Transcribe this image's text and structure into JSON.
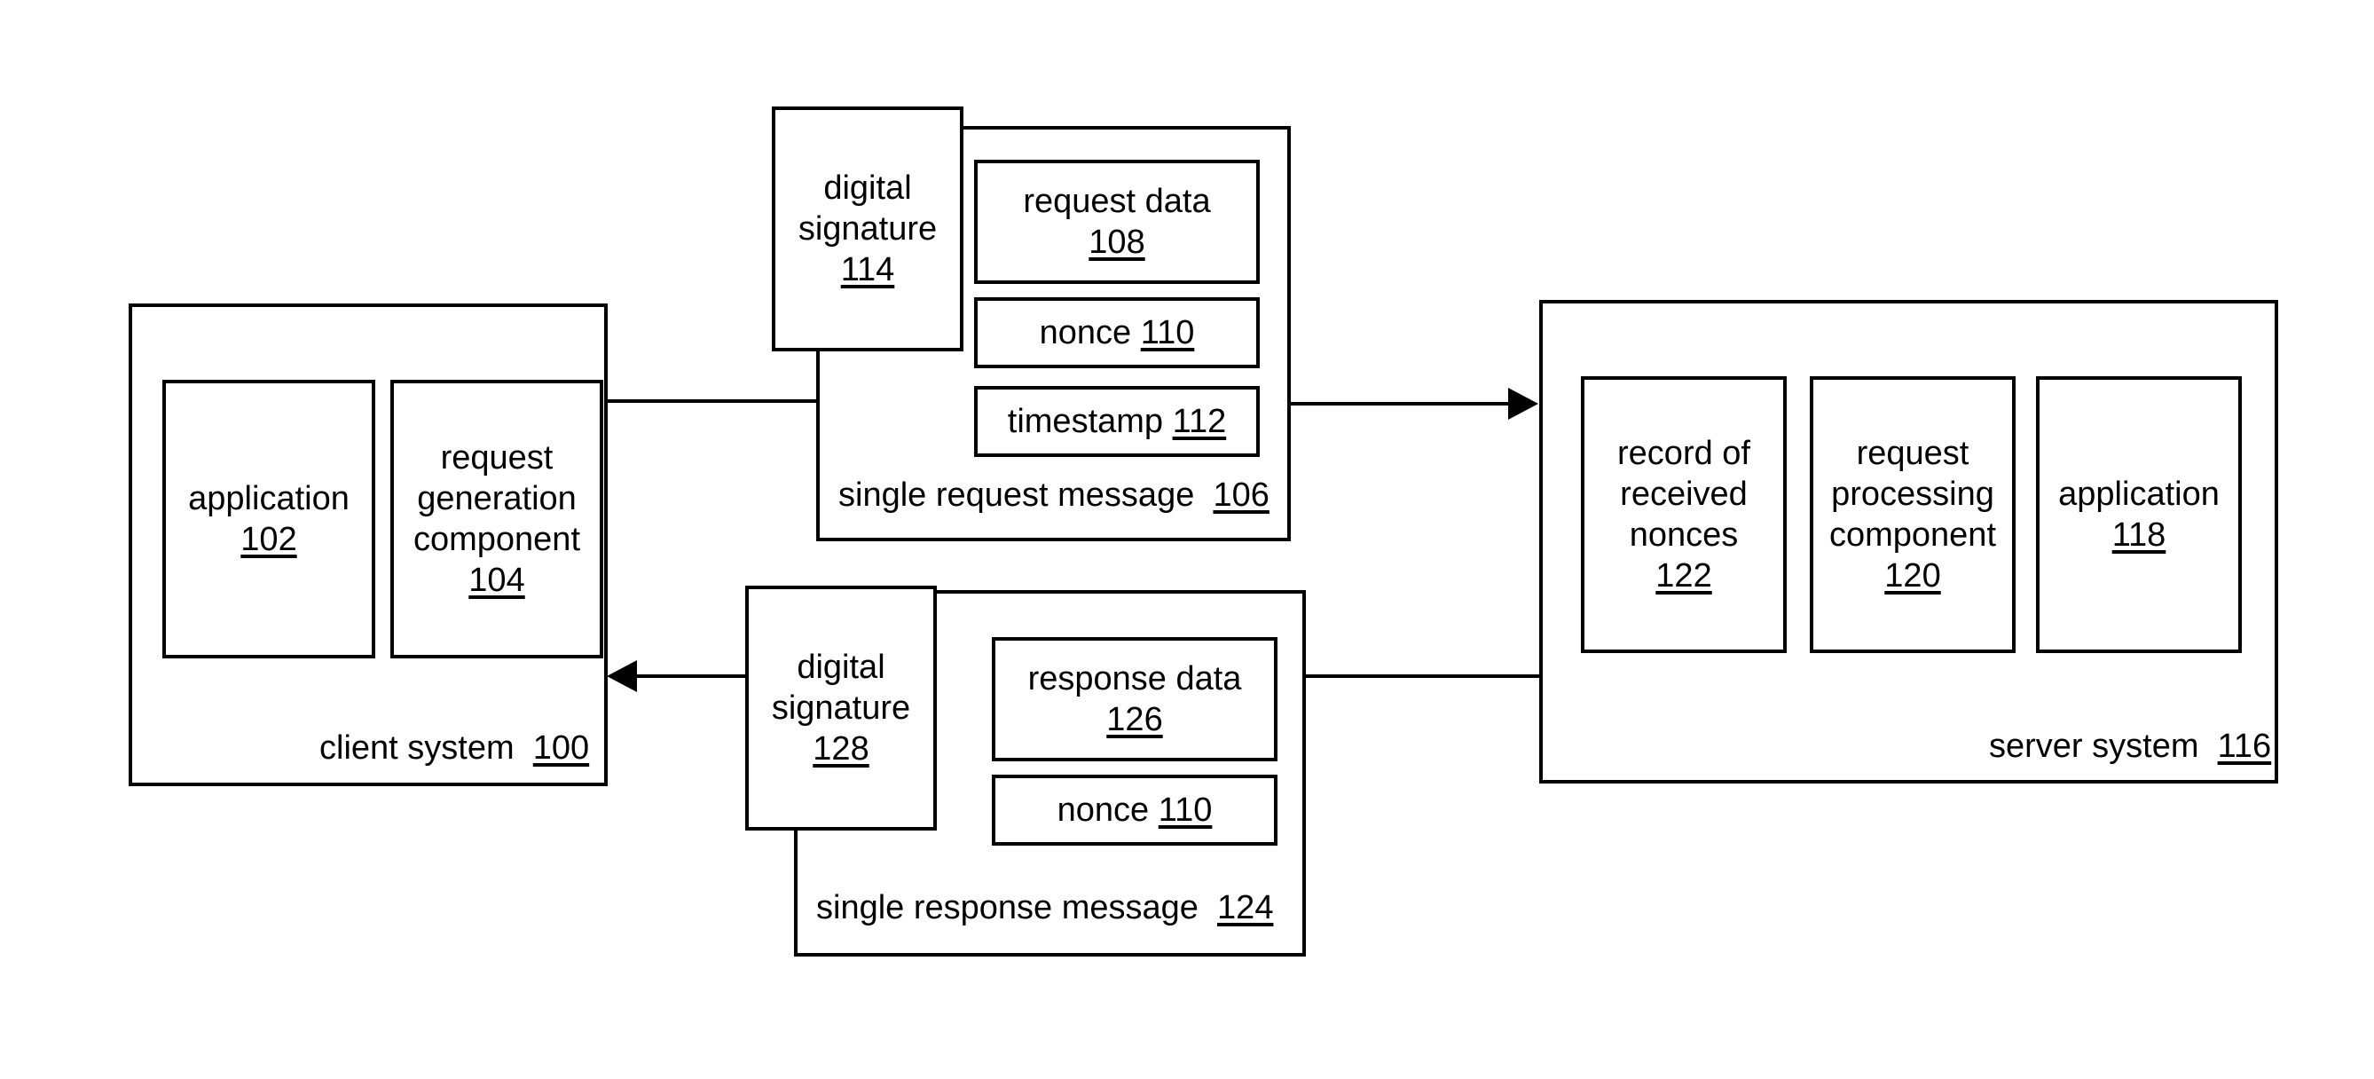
{
  "figure": {
    "type": "patent-block-diagram",
    "background_color": "#ffffff",
    "line_color": "#000000"
  },
  "client_system": {
    "label": "client system",
    "ref": "100",
    "blocks": [
      {
        "name": "application",
        "label": "application",
        "ref": "102"
      },
      {
        "name": "request-generation-component",
        "label": "request\ngeneration\ncomponent",
        "ref": "104"
      }
    ]
  },
  "request_message": {
    "label": "single request message",
    "ref": "106",
    "signature": {
      "label": "digital\nsignature",
      "ref": "114"
    },
    "fields": [
      {
        "name": "request-data",
        "label": "request data",
        "ref": "108",
        "inline": false
      },
      {
        "name": "nonce",
        "label": "nonce",
        "ref": "110",
        "inline": true
      },
      {
        "name": "timestamp",
        "label": "timestamp",
        "ref": "112",
        "inline": true
      }
    ]
  },
  "response_message": {
    "label": "single response message",
    "ref": "124",
    "signature": {
      "label": "digital\nsignature",
      "ref": "128"
    },
    "fields": [
      {
        "name": "response-data",
        "label": "response data",
        "ref": "126",
        "inline": false
      },
      {
        "name": "nonce",
        "label": "nonce",
        "ref": "110",
        "inline": true
      }
    ]
  },
  "server_system": {
    "label": "server system",
    "ref": "116",
    "blocks": [
      {
        "name": "record-of-received-nonces",
        "label": "record of\nreceived\nnonces",
        "ref": "122"
      },
      {
        "name": "request-processing-component",
        "label": "request\nprocessing\ncomponent",
        "ref": "120"
      },
      {
        "name": "application",
        "label": "application",
        "ref": "118"
      }
    ]
  },
  "connectors": [
    {
      "name": "client-to-request-message",
      "direction": "right",
      "arrowhead": false
    },
    {
      "name": "request-message-to-server",
      "direction": "right",
      "arrowhead": true
    },
    {
      "name": "server-to-response-message",
      "direction": "left",
      "arrowhead": false
    },
    {
      "name": "response-message-to-client",
      "direction": "left",
      "arrowhead": true
    }
  ]
}
